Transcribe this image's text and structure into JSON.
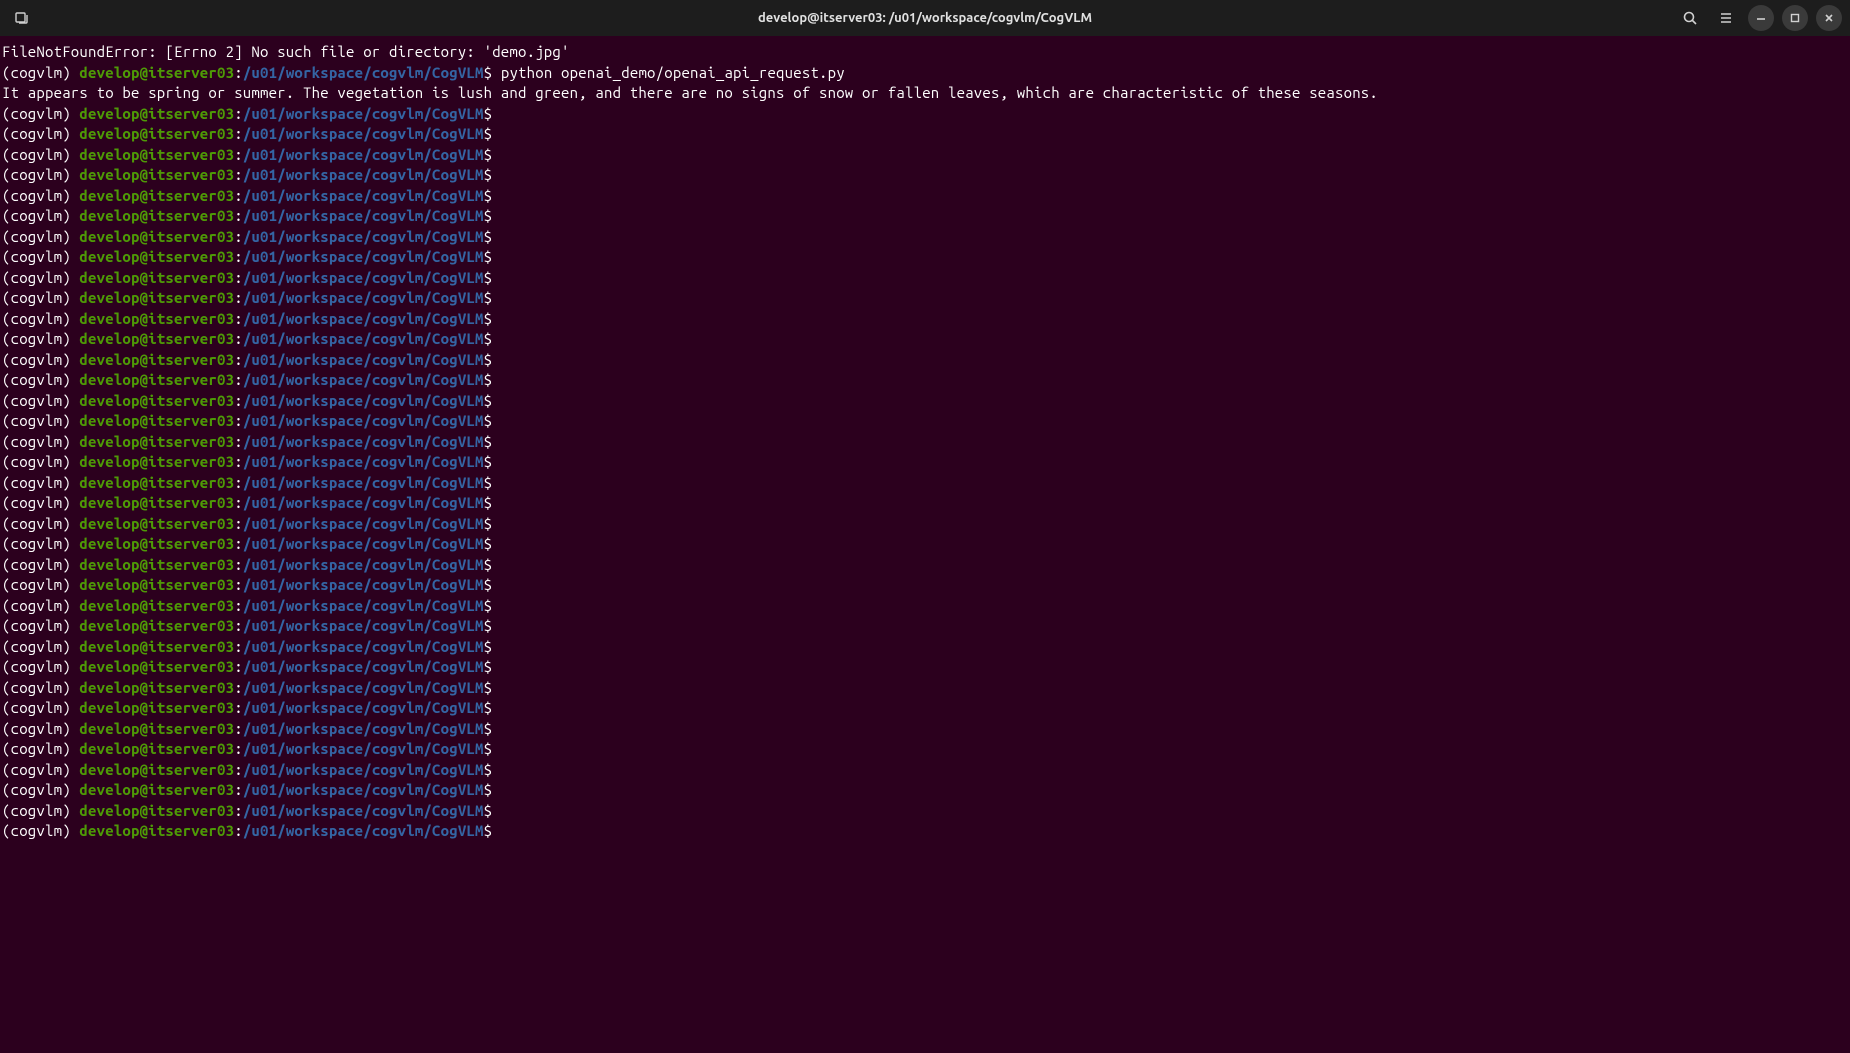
{
  "titlebar": {
    "title": "develop@itserver03: /u01/workspace/cogvlm/CogVLM"
  },
  "terminal": {
    "error_line": "FileNotFoundError: [Errno 2] No such file or directory: 'demo.jpg'",
    "env_prefix": "(cogvlm) ",
    "user_host": "develop@itserver03",
    "colon": ":",
    "path": "/u01/workspace/cogvlm/CogVLM",
    "dollar": "$",
    "command": " python openai_demo/openai_api_request.py",
    "output_line": "It appears to be spring or summer. The vegetation is lush and green, and there are no signs of snow or fallen leaves, which are characteristic of these seasons.",
    "empty_prompt_count": 36
  }
}
